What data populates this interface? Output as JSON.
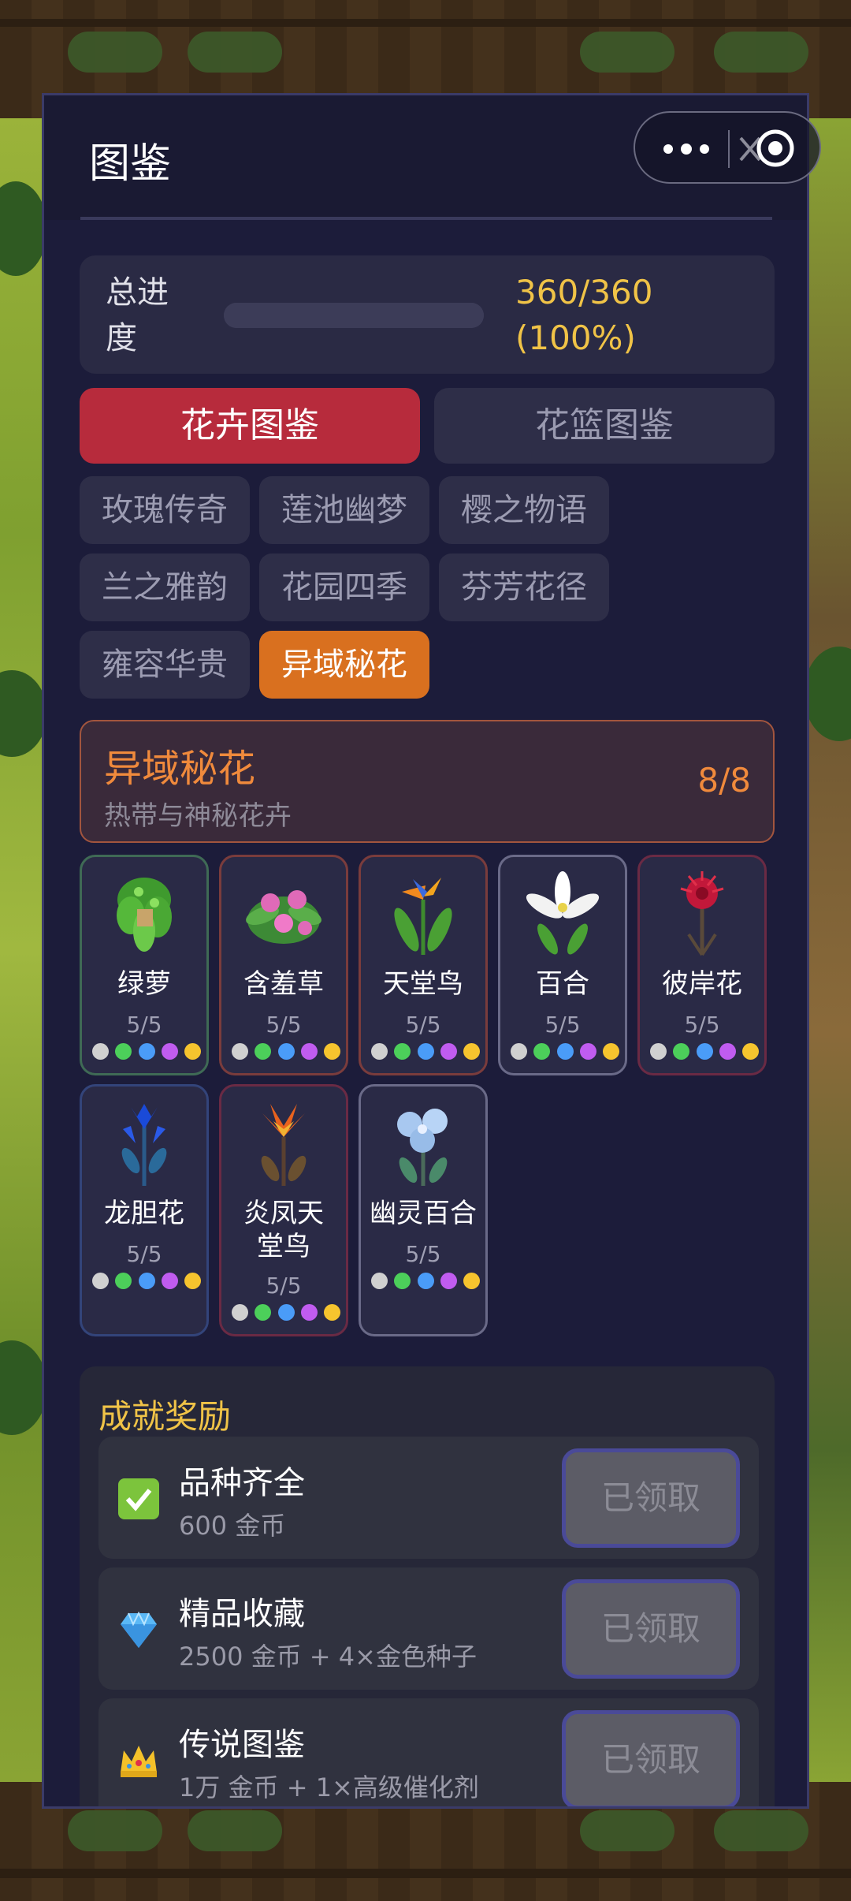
{
  "window": {
    "title": "图鉴"
  },
  "progress": {
    "label": "总进度",
    "value_text": "360/360\n(100%)",
    "fraction": 1.0
  },
  "main_tabs": [
    {
      "label": "花卉图鉴",
      "active": true
    },
    {
      "label": "花篮图鉴",
      "active": false
    }
  ],
  "categories": [
    {
      "label": "玫瑰传奇",
      "active": false
    },
    {
      "label": "莲池幽梦",
      "active": false
    },
    {
      "label": "樱之物语",
      "active": false
    },
    {
      "label": "兰之雅韵",
      "active": false
    },
    {
      "label": "花园四季",
      "active": false
    },
    {
      "label": "芬芳花径",
      "active": false
    },
    {
      "label": "雍容华贵",
      "active": false
    },
    {
      "label": "异域秘花",
      "active": true
    }
  ],
  "set": {
    "title": "异域秘花",
    "subtitle": "热带与神秘花卉",
    "count": "8/8"
  },
  "flowers": [
    {
      "name": "绿萝",
      "count": "5/5",
      "icon": "pothos-icon"
    },
    {
      "name": "含羞草",
      "count": "5/5",
      "icon": "mimosa-icon"
    },
    {
      "name": "天堂鸟",
      "count": "5/5",
      "icon": "bird-of-paradise-icon"
    },
    {
      "name": "百合",
      "count": "5/5",
      "icon": "lily-icon"
    },
    {
      "name": "彼岸花",
      "count": "5/5",
      "icon": "spider-lily-icon"
    },
    {
      "name": "龙胆花",
      "count": "5/5",
      "icon": "gentian-icon"
    },
    {
      "name": "炎凤天堂鸟",
      "count": "5/5",
      "icon": "fire-phoenix-icon"
    },
    {
      "name": "幽灵百合",
      "count": "5/5",
      "icon": "ghost-lily-icon"
    }
  ],
  "rarity_colors": [
    "#d0d0d0",
    "#4ccf5a",
    "#4a9cf8",
    "#c05cf0",
    "#f6c42e"
  ],
  "achievements": {
    "title": "成就奖励",
    "items": [
      {
        "name": "品种齐全",
        "reward": "600 金币",
        "button": "已领取",
        "icon": "checkbox-icon"
      },
      {
        "name": "精品收藏",
        "reward": "2500 金币 + 4×金色种子",
        "button": "已领取",
        "icon": "diamond-icon"
      },
      {
        "name": "传说图鉴",
        "reward": "1万 金币 + 1×高级催化剂",
        "button": "已领取",
        "icon": "crown-icon"
      }
    ]
  },
  "colors": {
    "accent_red": "#b72b3c",
    "accent_orange": "#d9701f",
    "gold": "#f0c347"
  }
}
